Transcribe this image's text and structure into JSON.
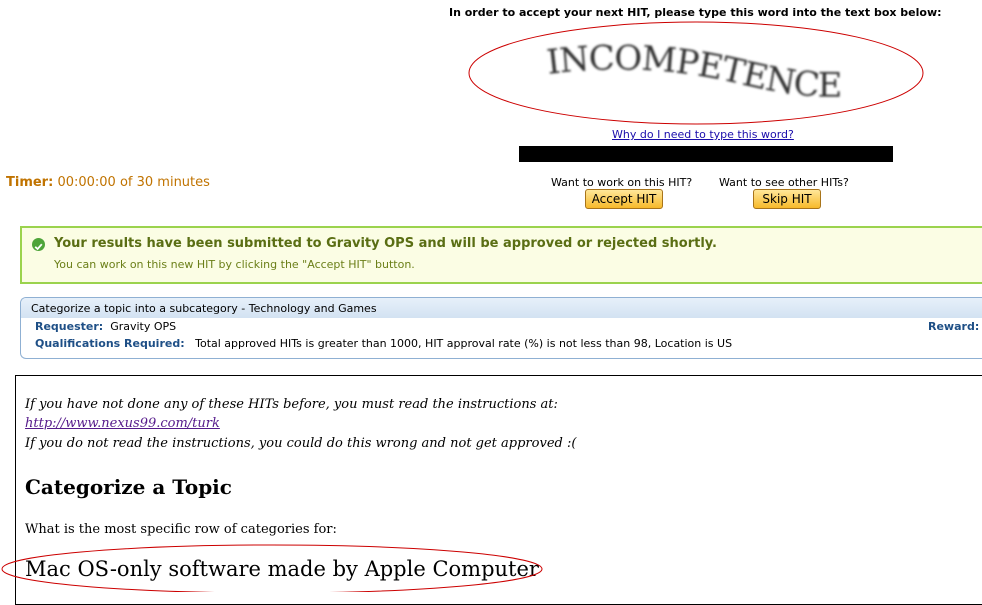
{
  "captcha": {
    "prompt": "In order to accept your next HIT, please type this word into the text box below:",
    "word": "INCOMPETENCE",
    "why_link": "Why do I need to type this word?",
    "input_value": ""
  },
  "timer": {
    "label": "Timer:",
    "value": "00:00:00 of 30 minutes"
  },
  "actions": {
    "accept_prompt": "Want to work on this HIT?",
    "accept_button": "Accept HIT",
    "skip_prompt": "Want to see other HITs?",
    "skip_button": "Skip HIT"
  },
  "notice": {
    "title": "Your results have been submitted to Gravity OPS and will be approved or rejected shortly.",
    "subtitle": "You can work on this new HIT by clicking the \"Accept HIT\" button."
  },
  "hit": {
    "title": "Categorize a topic into a subcategory - Technology and Games",
    "requester_label": "Requester:",
    "requester_value": "Gravity OPS",
    "reward_label": "Reward:",
    "qualifications_label": "Qualifications Required:",
    "qualifications_value": "Total approved HITs is greater than 1000, HIT approval rate (%) is not less than 98, Location is US"
  },
  "content": {
    "instr_line1": "If you have not done any of these HITs before, you must read the instructions at:",
    "instr_link": "http://www.nexus99.com/turk",
    "instr_line2": "If you do not read the instructions, you could do this wrong and not get approved :(",
    "heading": "Categorize a Topic",
    "question": "What is the most specific row of categories for:",
    "topic": "Mac OS-only software made by Apple Computer"
  },
  "colors": {
    "annotation_red": "#cc0000",
    "notice_border": "#9bd34d",
    "timer_orange": "#c07300",
    "label_blue": "#1e4f86"
  }
}
